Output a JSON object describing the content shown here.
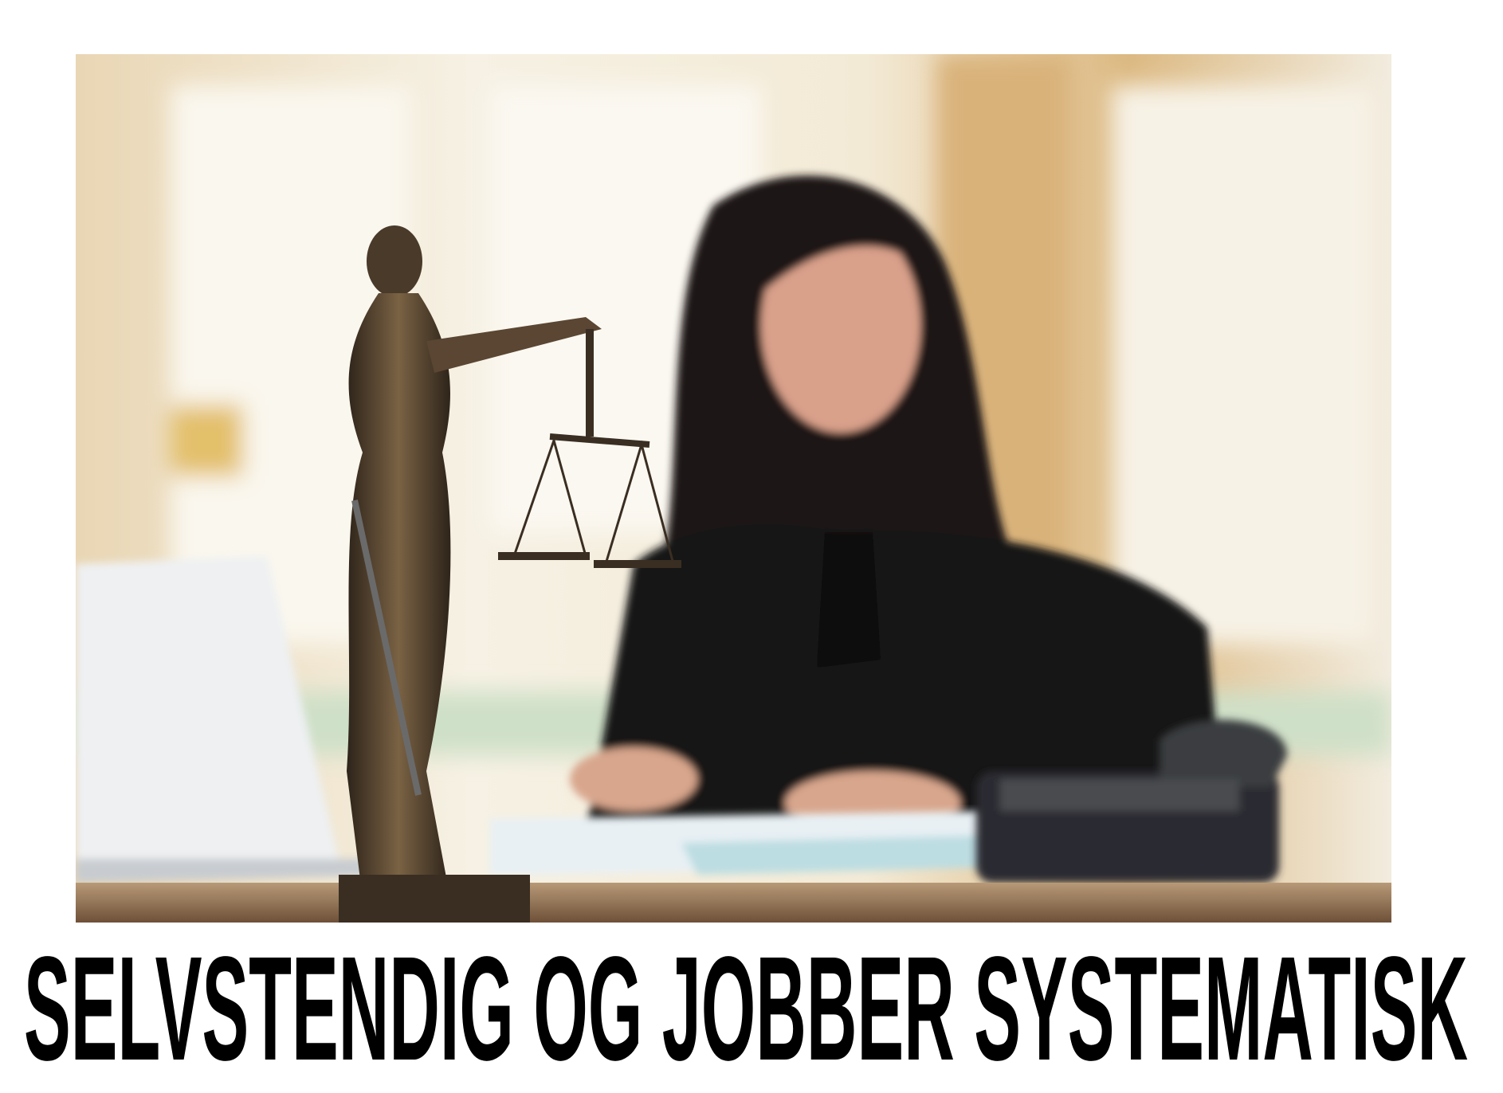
{
  "photo": {
    "subject": "Woman writing at desk beside a Lady Justice statue",
    "colors": {
      "window": "#f2ead8",
      "wood": "#c9a06a",
      "hair": "#1a1412",
      "jacket": "#141414",
      "statue": "#4a3a2a",
      "desk": "#8a6a48"
    }
  },
  "caption": {
    "text": "SELVSTENDIG OG JOBBER SYSTEMATISK",
    "color": "#000000"
  }
}
